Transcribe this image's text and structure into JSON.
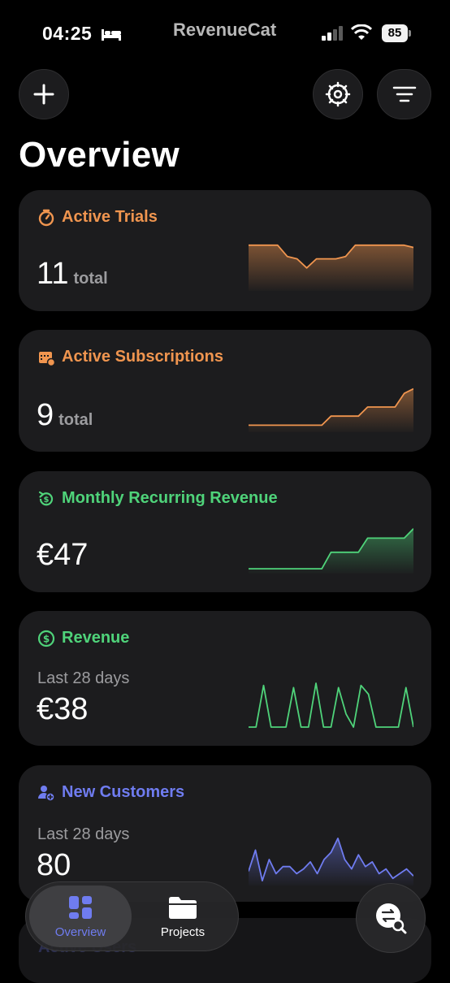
{
  "status_bar": {
    "time": "04:25",
    "brand": "RevenueCat",
    "battery": "85"
  },
  "header": {
    "title": "Overview"
  },
  "cards": [
    {
      "title": "Active Trials",
      "value": "11",
      "unit": "total",
      "color": "#f0954f",
      "icon": "timer-icon",
      "spark": [
        0.95,
        0.95,
        0.95,
        0.95,
        0.7,
        0.65,
        0.45,
        0.65,
        0.65,
        0.65,
        0.7,
        0.95,
        0.95,
        0.95,
        0.95,
        0.95,
        0.95,
        0.9
      ]
    },
    {
      "title": "Active Subscriptions",
      "value": "9",
      "unit": "total",
      "color": "#f0954f",
      "icon": "calendar-icon",
      "spark": [
        0.1,
        0.1,
        0.1,
        0.1,
        0.1,
        0.1,
        0.1,
        0.1,
        0.1,
        0.3,
        0.3,
        0.3,
        0.3,
        0.5,
        0.5,
        0.5,
        0.5,
        0.8,
        0.9
      ]
    },
    {
      "title": "Monthly Recurring Revenue",
      "value": "€47",
      "unit": "",
      "color": "#4fd37a",
      "icon": "recurring-dollar-icon",
      "spark": [
        0.05,
        0.05,
        0.05,
        0.05,
        0.05,
        0.05,
        0.05,
        0.05,
        0.05,
        0.4,
        0.4,
        0.4,
        0.4,
        0.7,
        0.7,
        0.7,
        0.7,
        0.7,
        0.9
      ]
    },
    {
      "title": "Revenue",
      "subtitle": "Last 28 days",
      "value": "€38",
      "unit": "",
      "color": "#4fd37a",
      "icon": "dollar-circle-icon",
      "spark": [
        0,
        0,
        0.95,
        0,
        0,
        0,
        0.9,
        0,
        0,
        1,
        0,
        0,
        0.9,
        0.3,
        0,
        0.95,
        0.75,
        0,
        0,
        0,
        0,
        0.9,
        0
      ]
    },
    {
      "title": "New Customers",
      "subtitle": "Last 28 days",
      "value": "80",
      "unit": "",
      "color": "#6f7cf0",
      "icon": "person-add-icon",
      "spark": [
        0.25,
        0.7,
        0.05,
        0.5,
        0.2,
        0.35,
        0.35,
        0.2,
        0.3,
        0.45,
        0.2,
        0.5,
        0.65,
        0.95,
        0.5,
        0.3,
        0.6,
        0.35,
        0.45,
        0.2,
        0.3,
        0.1,
        0.2,
        0.3,
        0.15
      ]
    }
  ],
  "peek": {
    "label": "Active Users"
  },
  "tabs": {
    "overview": "Overview",
    "projects": "Projects"
  }
}
